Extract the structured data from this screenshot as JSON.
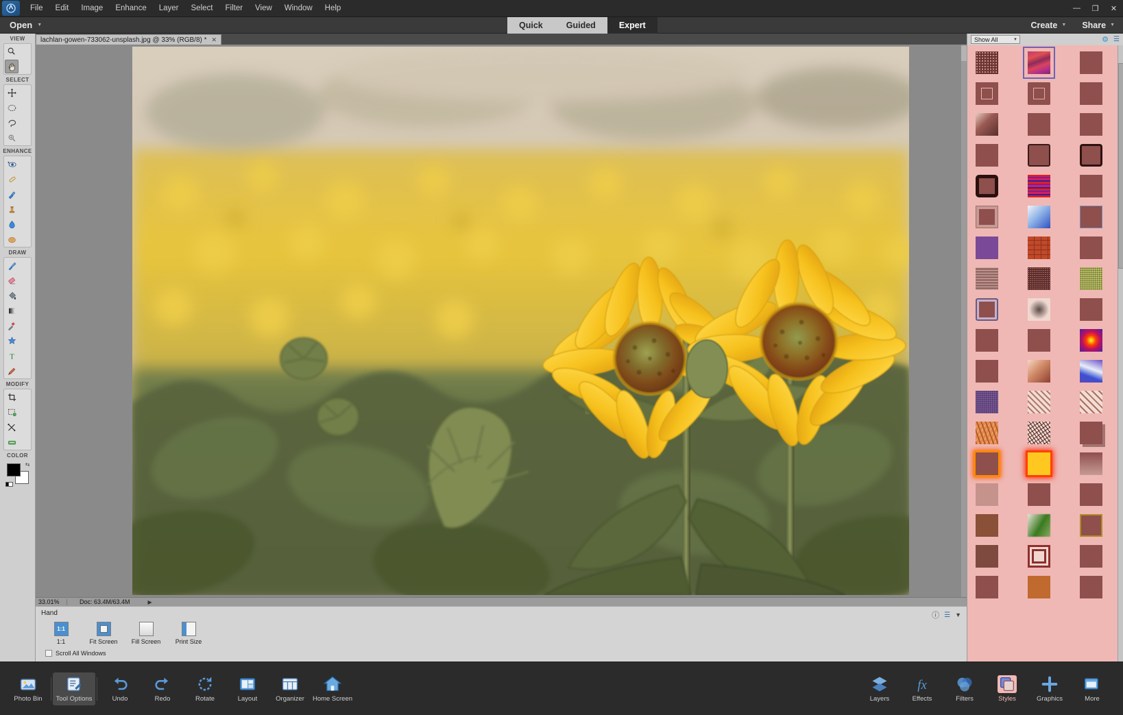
{
  "app": {
    "logo_icon": "photoshop-elements-logo",
    "menus": [
      "File",
      "Edit",
      "Image",
      "Enhance",
      "Layer",
      "Select",
      "Filter",
      "View",
      "Window",
      "Help"
    ],
    "window_controls": [
      {
        "name": "minimize",
        "glyph": "—"
      },
      {
        "name": "maximize",
        "glyph": "❐"
      },
      {
        "name": "close",
        "glyph": "✕"
      }
    ]
  },
  "openbar": {
    "open_label": "Open",
    "modes": [
      {
        "label": "Quick",
        "active": false
      },
      {
        "label": "Guided",
        "active": false
      },
      {
        "label": "Expert",
        "active": true
      }
    ],
    "create_label": "Create",
    "share_label": "Share"
  },
  "document": {
    "tab_title": "lachlan-gowen-733062-unsplash.jpg @ 33% (RGB/8) *",
    "close_glyph": "✕"
  },
  "toolbar": {
    "sections": [
      {
        "label": "VIEW",
        "tools": [
          {
            "name": "zoom-tool",
            "icon": "magnifier-icon",
            "active": false
          },
          {
            "name": "hand-tool",
            "icon": "hand-icon",
            "active": true
          }
        ]
      },
      {
        "label": "SELECT",
        "tools": [
          {
            "name": "move-tool",
            "icon": "move-arrow-icon",
            "active": false
          },
          {
            "name": "marquee-tool",
            "icon": "dashed-ellipse-icon",
            "active": false
          },
          {
            "name": "lasso-tool",
            "icon": "lasso-icon",
            "active": false
          },
          {
            "name": "quick-selection-tool",
            "icon": "quick-select-wand-icon",
            "active": false
          }
        ]
      },
      {
        "label": "ENHANCE",
        "tools": [
          {
            "name": "red-eye-tool",
            "icon": "eye-icon",
            "active": false
          },
          {
            "name": "spot-healing-tool",
            "icon": "healing-bandage-icon",
            "active": false
          },
          {
            "name": "smart-brush-tool",
            "icon": "smart-brush-icon",
            "active": false
          },
          {
            "name": "clone-stamp-tool",
            "icon": "stamp-icon",
            "active": false
          },
          {
            "name": "blur-tool",
            "icon": "water-drop-icon",
            "active": false
          },
          {
            "name": "sponge-tool",
            "icon": "sponge-icon",
            "active": false
          }
        ]
      },
      {
        "label": "DRAW",
        "tools": [
          {
            "name": "brush-tool",
            "icon": "paintbrush-icon",
            "active": false
          },
          {
            "name": "eraser-tool",
            "icon": "eraser-icon",
            "active": false
          },
          {
            "name": "paint-bucket-tool",
            "icon": "paint-bucket-icon",
            "active": false
          },
          {
            "name": "gradient-tool",
            "icon": "gradient-icon",
            "active": false
          },
          {
            "name": "eyedropper-tool",
            "icon": "eyedropper-icon",
            "active": false
          },
          {
            "name": "shape-tool",
            "icon": "shape-star-icon",
            "active": false
          },
          {
            "name": "type-tool",
            "icon": "type-t-icon",
            "active": false
          },
          {
            "name": "pencil-tool",
            "icon": "pencil-icon",
            "active": false
          }
        ]
      },
      {
        "label": "MODIFY",
        "tools": [
          {
            "name": "crop-tool",
            "icon": "crop-icon",
            "active": false
          },
          {
            "name": "cookie-cutter-tool",
            "icon": "cookie-cutter-icon",
            "active": false
          },
          {
            "name": "recompose-tool",
            "icon": "recompose-icon",
            "active": false
          },
          {
            "name": "content-aware-move-tool",
            "icon": "content-move-icon",
            "active": false
          }
        ]
      }
    ],
    "color_label": "COLOR",
    "foreground_color": "#000000",
    "background_color": "#ffffff"
  },
  "statusbar": {
    "zoom": "33.01%",
    "doc_size": "Doc: 63.4M/63.4M"
  },
  "tool_options": {
    "title": "Hand",
    "presets": [
      {
        "label": "1:1",
        "name": "one-to-one",
        "active": true
      },
      {
        "label": "Fit Screen",
        "name": "fit-screen",
        "active": false
      },
      {
        "label": "Fill Screen",
        "name": "fill-screen",
        "active": false
      },
      {
        "label": "Print Size",
        "name": "print-size",
        "active": false
      }
    ],
    "scroll_all_label": "Scroll All Windows",
    "scroll_all_checked": false,
    "help_icon": "help-question-icon",
    "menu_icon": "panel-menu-icon",
    "collapse_icon": "chevron-down-icon"
  },
  "right_panel": {
    "filter_value": "Show All",
    "gear_icon": "gear-icon",
    "menu_icon": "panel-menu-icon",
    "accent_bg": "#efb8b4",
    "selected_index": 1,
    "styles": [
      {
        "name": "noise-speckle-dark",
        "css": "background:#5c2a2a;background-image:radial-gradient(#d8a89a 0.8px,transparent 0.9px),radial-gradient(#8f4a44 0.8px,transparent 0.9px);background-size:4px 4px,3px 3px;background-position:0 0,2px 2px;"
      },
      {
        "name": "magenta-marble",
        "css": "background:linear-gradient(160deg,#c03a7a 0%,#e0504f 25%,#8e2a5e 45%,#d9455c 62%,#b4308a 80%,#7e2a66 100%);"
      },
      {
        "name": "flat-maroon-a",
        "css": "background:#8e4f4d;"
      },
      {
        "name": "inner-square-outline",
        "css": "background:#8e4f4d;box-shadow:inset 0 0 0 8px #8e4f4d, inset 0 0 0 9px #e8b9ac;"
      },
      {
        "name": "inner-rounded-outline",
        "css": "background:#8e4f4d;box-shadow:inset 0 0 0 8px #8e4f4d, inset 0 0 0 9px #e0ada0;border-radius:2px;"
      },
      {
        "name": "flat-maroon-b",
        "css": "background:#8e4f4d;"
      },
      {
        "name": "soft-diagonal-glow",
        "css": "background:#6f3b39;background-image:linear-gradient(135deg,#e8c9bd 0%,#9a5a54 42%,#5a2e2c 100%);"
      },
      {
        "name": "flat-maroon-c",
        "css": "background:#8e4f4d;"
      },
      {
        "name": "flat-maroon-d",
        "css": "background:#8e4f4d;"
      },
      {
        "name": "flat-maroon-e",
        "css": "background:#8e4f4d;"
      },
      {
        "name": "thin-dark-border",
        "css": "background:#8e4f4d;border:2px solid #3b1b1a;border-radius:3px;"
      },
      {
        "name": "thick-dark-border",
        "css": "background:#8e4f4d;border:3px solid #2e1211;border-radius:4px;"
      },
      {
        "name": "heavy-dark-border",
        "css": "background:#8e4f4d;border:5px solid #2a100f;border-radius:5px;"
      },
      {
        "name": "red-stripes",
        "css": "background:repeating-linear-gradient(180deg,#e02020 0 3px,#7a1fa0 3px 5px,#d02060 5px 8px,#3020a0 8px 10px);"
      },
      {
        "name": "flat-maroon-f",
        "css": "background:#8e4f4d;"
      },
      {
        "name": "pale-bevel-frame",
        "css": "background:#8e4f4d;box-shadow:inset 0 0 0 4px #c89a93;border:1px solid #9a6f68;"
      },
      {
        "name": "blue-white-gradient",
        "css": "background:linear-gradient(135deg,#f4f4f8 0%,#8fb4e8 45%,#3050c0 100%);"
      },
      {
        "name": "flat-maroon-g",
        "css": "background:#8e4f4d;border:1px solid #6e8ab8;"
      },
      {
        "name": "violet-flat",
        "css": "background:#7a4a98;"
      },
      {
        "name": "brick-pattern",
        "css": "background:#c0492a;background-image:repeating-linear-gradient(0deg,transparent 0 6px,#8e3018 6px 7px),repeating-linear-gradient(90deg,transparent 0 9px,#8e3018 9px 10px);"
      },
      {
        "name": "flat-maroon-h",
        "css": "background:#8e4f4d;"
      },
      {
        "name": "horizontal-streaks",
        "css": "background:#9a6a64;background-image:repeating-linear-gradient(0deg,rgba(255,255,255,.45) 0 1px,transparent 1px 4px);"
      },
      {
        "name": "dark-speckle",
        "css": "background:#5c2a2a;background-image:radial-gradient(#c89a8a 0.7px,transparent 0.8px),radial-gradient(#7a3a34 0.7px,transparent 0.8px);background-size:3px 3px,4px 4px;"
      },
      {
        "name": "olive-speckle",
        "css": "background:#b9bd6a;background-image:radial-gradient(#6a6e2a 0.8px,transparent 0.9px);background-size:3px 3px;"
      },
      {
        "name": "double-bevel-frame",
        "css": "background:#8e4f4d;box-shadow:inset 0 0 0 3px #c8b0c8, inset 0 0 0 5px #8e4f4d;border:2px solid #6a5a80;border-radius:3px;"
      },
      {
        "name": "soft-radial-blob",
        "css": "background:#f0d8d0;background-image:radial-gradient(circle at 50% 50%,#5a4a48 0%,rgba(90,74,72,0) 62%);"
      },
      {
        "name": "flat-maroon-i",
        "css": "background:#8e4f4d;"
      },
      {
        "name": "flat-maroon-j",
        "css": "background:#8e4f4d;"
      },
      {
        "name": "flat-maroon-k",
        "css": "background:#8e4f4d;"
      },
      {
        "name": "red-glow-orb",
        "css": "background:#4a20a0;background-image:radial-gradient(circle at 50% 50%,#ffff20 0%,#ff4000 30%,#c01060 55%,#4a20a0 100%);"
      },
      {
        "name": "flat-maroon-l",
        "css": "background:#8e4f4d;"
      },
      {
        "name": "peach-diagonal",
        "css": "background:linear-gradient(135deg,#f5d5c0 0%,#d08a68 45%,#8e4030 100%);"
      },
      {
        "name": "blue-swirl",
        "css": "background:linear-gradient(200deg,#6a50c8 0%,#e8eef8 42%,#3a50d0 70%,#5a48c0 100%);"
      },
      {
        "name": "purple-fabric",
        "css": "background:#6a4a88;background-image:repeating-linear-gradient(90deg,rgba(0,0,0,.2) 0 1px,transparent 1px 3px),repeating-linear-gradient(0deg,rgba(255,255,255,.12) 0 1px,transparent 1px 3px);"
      },
      {
        "name": "pale-diagonal-hatch",
        "css": "background:#f2dcd4;background-image:repeating-linear-gradient(45deg,#b07a6c 0 2px,transparent 2px 6px);"
      },
      {
        "name": "pale-hatch-b",
        "css": "background:#f2dcd4;background-image:repeating-linear-gradient(45deg,#a8705f 0 2px,transparent 2px 7px);"
      },
      {
        "name": "orange-wave-texture",
        "css": "background:#e08a50;background-image:repeating-linear-gradient(70deg,#b85a22 0 2px,transparent 2px 6px),repeating-linear-gradient(-60deg,#f0b080 0 1px,transparent 1px 5px);"
      },
      {
        "name": "fine-scratch-texture",
        "css": "background:#efd8d0;background-image:repeating-linear-gradient(55deg,#4a2220 0 1px,transparent 1px 4px),repeating-linear-gradient(-35deg,#6a3a30 0 1px,transparent 1px 5px);"
      },
      {
        "name": "drop-shadow-square",
        "css": "background:#8e4f4d;box-shadow:4px 4px 0 rgba(70,30,28,.45);"
      },
      {
        "name": "orange-outer-glow",
        "css": "background:#8e4f4d;box-shadow:0 0 0 3px #ff8a00, 0 0 7px 4px #ff5a00;"
      },
      {
        "name": "yellow-fire-glow",
        "css": "background:#ffc820;box-shadow:0 0 0 3px #ff4000, 0 0 8px 4px #ff2000;"
      },
      {
        "name": "vertical-fade",
        "css": "background:linear-gradient(180deg,#8e4f4d 0%,#c79a92 100%);"
      },
      {
        "name": "light-rose-flat",
        "css": "background:#c6928c;"
      },
      {
        "name": "flat-maroon-m",
        "css": "background:#8e4f4d;"
      },
      {
        "name": "flat-maroon-n",
        "css": "background:#8e4f4d;"
      },
      {
        "name": "brown-flat",
        "css": "background:#8a5038;"
      },
      {
        "name": "green-blur-patch",
        "css": "background:#f0ece0;background-image:linear-gradient(120deg,#e8e4d8 0%,#3a7a20 55%,#8aa860 100%);filter:blur(.4px);"
      },
      {
        "name": "gold-edged-square",
        "css": "background:#8e4f4d;border:2px solid #b08a28;"
      },
      {
        "name": "flat-brown-b",
        "css": "background:#7e4a40;"
      },
      {
        "name": "nested-outline-square",
        "css": "background:#f0d8d0;box-shadow:inset 0 0 0 3px #8e2f2d, inset 0 0 0 6px #f0d8d0, inset 0 0 0 9px #8e2f2d;"
      },
      {
        "name": "flat-maroon-o",
        "css": "background:#8e4f4d;"
      },
      {
        "name": "flat-maroon-p",
        "css": "background:#8e4f4d;"
      },
      {
        "name": "orange-flat",
        "css": "background:#c06a30;"
      },
      {
        "name": "flat-maroon-q",
        "css": "background:#8e4f4d;"
      }
    ]
  },
  "taskbar": {
    "left_items": [
      {
        "label": "Photo Bin",
        "name": "photo-bin",
        "icon": "photo-bin-icon",
        "active": false
      },
      {
        "label": "Tool Options",
        "name": "tool-options",
        "icon": "tool-options-icon",
        "active": true
      },
      {
        "label": "Undo",
        "name": "undo",
        "icon": "undo-arrow-icon",
        "active": false
      },
      {
        "label": "Redo",
        "name": "redo",
        "icon": "redo-arrow-icon",
        "active": false
      },
      {
        "label": "Rotate",
        "name": "rotate",
        "icon": "rotate-icon",
        "active": false
      },
      {
        "label": "Layout",
        "name": "layout",
        "icon": "layout-icon",
        "active": false
      },
      {
        "label": "Organizer",
        "name": "organizer",
        "icon": "organizer-grid-icon",
        "active": false
      },
      {
        "label": "Home Screen",
        "name": "home-screen",
        "icon": "home-icon",
        "active": false
      }
    ],
    "right_items": [
      {
        "label": "Layers",
        "name": "layers",
        "icon": "layers-stack-icon",
        "active": false
      },
      {
        "label": "Effects",
        "name": "effects",
        "icon": "fx-icon",
        "active": false
      },
      {
        "label": "Filters",
        "name": "filters",
        "icon": "filters-circles-icon",
        "active": false
      },
      {
        "label": "Styles",
        "name": "styles",
        "icon": "styles-squares-icon",
        "active": true
      },
      {
        "label": "Graphics",
        "name": "graphics",
        "icon": "plus-icon",
        "active": false
      },
      {
        "label": "More",
        "name": "more",
        "icon": "more-panel-icon",
        "active": false
      }
    ]
  },
  "photo": {
    "subject": "two sunflowers in a sunflower field at golden hour",
    "sky_color": "#d8cdbe",
    "field_color": "#e8c63c",
    "foliage_color": "#4a5a3a",
    "petal_color": "#f5c518"
  }
}
